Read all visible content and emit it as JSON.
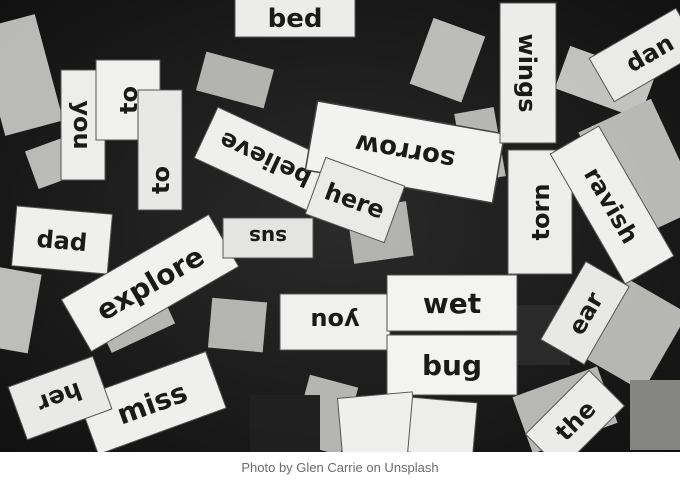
{
  "caption": "Photo by Glen Carrie on Unsplash",
  "photo": {
    "subject": "magnetic-poetry-word-tiles",
    "words": {
      "bed": "bed",
      "you": "you",
      "to": "to",
      "to2": "to",
      "believe": "believe",
      "sorrow": "sorrow",
      "wings": "wings",
      "dan": "dan",
      "dad": "dad",
      "explore": "explore",
      "here": "here",
      "torn": "torn",
      "ravish": "ravish",
      "you2": "you",
      "wet": "wet",
      "bug": "bug",
      "miss": "miss",
      "her": "her",
      "ear": "ear",
      "sus": "sus",
      "the": "the"
    }
  }
}
